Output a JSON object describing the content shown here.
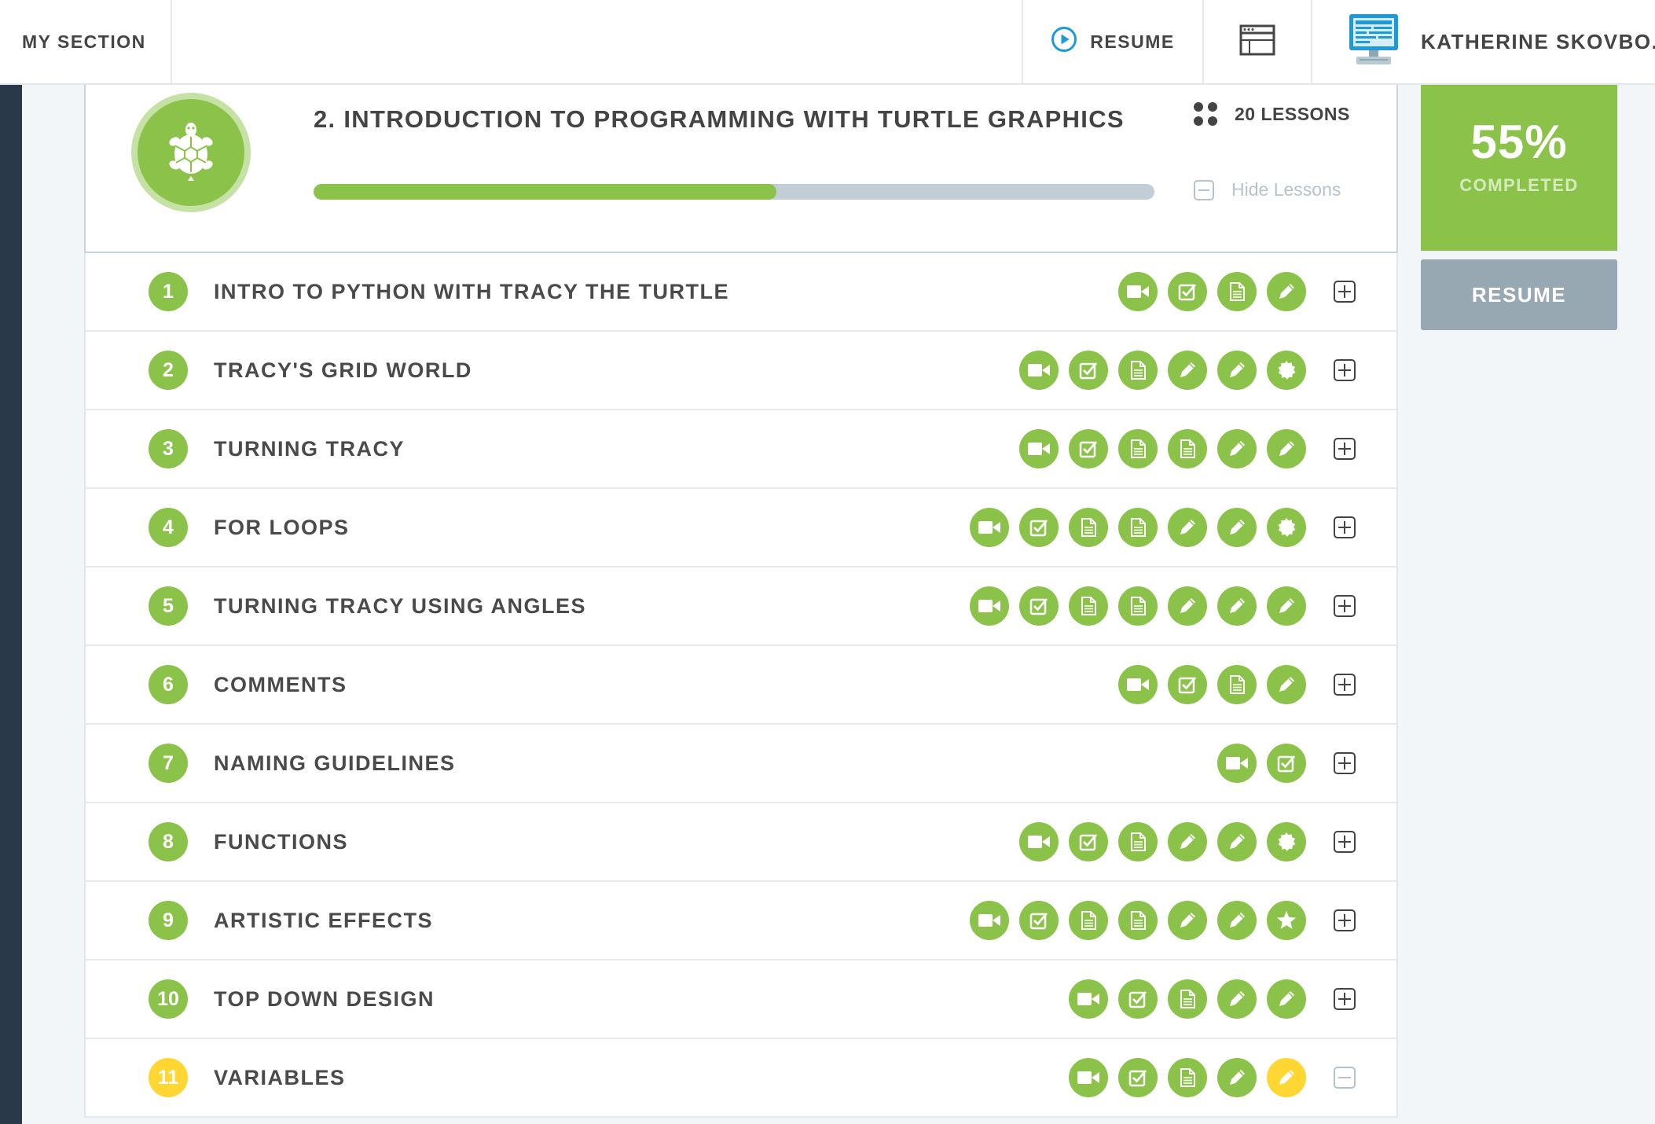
{
  "topbar": {
    "section_label": "MY SECTION",
    "resume_label": "RESUME",
    "user_name": "KATHERINE SKOVBO..."
  },
  "module": {
    "title": "2. INTRODUCTION TO PROGRAMMING WITH TURTLE GRAPHICS",
    "lessons_count": "20 LESSONS",
    "progress_fraction": 0.55,
    "hide_lessons_label": "Hide Lessons"
  },
  "sidebar": {
    "percent": "55%",
    "completed_label": "COMPLETED",
    "resume_label": "RESUME"
  },
  "colors": {
    "green": "#8bc34a",
    "yellow": "#ffd632",
    "gray_button": "#98a8b2",
    "dark_strip": "#293949"
  },
  "lessons": [
    {
      "num": "1",
      "title": "INTRO TO PYTHON WITH TRACY THE TURTLE",
      "current": false,
      "activities": [
        "video",
        "check",
        "doc",
        "pencil"
      ]
    },
    {
      "num": "2",
      "title": "TRACY'S GRID WORLD",
      "current": false,
      "activities": [
        "video",
        "check",
        "doc",
        "pencil",
        "pencil",
        "badge"
      ]
    },
    {
      "num": "3",
      "title": "TURNING TRACY",
      "current": false,
      "activities": [
        "video",
        "check",
        "doc",
        "doc",
        "pencil",
        "pencil"
      ]
    },
    {
      "num": "4",
      "title": "FOR LOOPS",
      "current": false,
      "activities": [
        "video",
        "check",
        "doc",
        "doc",
        "pencil",
        "pencil",
        "badge"
      ]
    },
    {
      "num": "5",
      "title": "TURNING TRACY USING ANGLES",
      "current": false,
      "activities": [
        "video",
        "check",
        "doc",
        "doc",
        "pencil",
        "pencil",
        "pencil"
      ]
    },
    {
      "num": "6",
      "title": "COMMENTS",
      "current": false,
      "activities": [
        "video",
        "check",
        "doc",
        "pencil"
      ]
    },
    {
      "num": "7",
      "title": "NAMING GUIDELINES",
      "current": false,
      "activities": [
        "video",
        "check"
      ]
    },
    {
      "num": "8",
      "title": "FUNCTIONS",
      "current": false,
      "activities": [
        "video",
        "check",
        "doc",
        "pencil",
        "pencil",
        "badge"
      ]
    },
    {
      "num": "9",
      "title": "ARTISTIC EFFECTS",
      "current": false,
      "activities": [
        "video",
        "check",
        "doc",
        "doc",
        "pencil",
        "pencil",
        "star"
      ]
    },
    {
      "num": "10",
      "title": "TOP DOWN DESIGN",
      "current": false,
      "activities": [
        "video",
        "check",
        "doc",
        "pencil",
        "pencil"
      ]
    },
    {
      "num": "11",
      "title": "VARIABLES",
      "current": true,
      "activities": [
        "video",
        "check",
        "doc",
        "pencil",
        "pencil-current"
      ]
    }
  ]
}
